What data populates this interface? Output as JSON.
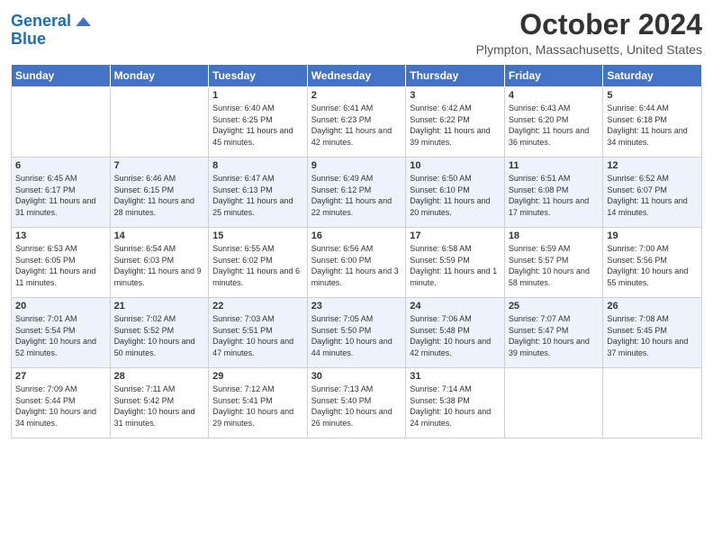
{
  "header": {
    "logo_line1": "General",
    "logo_line2": "Blue",
    "month": "October 2024",
    "location": "Plympton, Massachusetts, United States"
  },
  "days_of_week": [
    "Sunday",
    "Monday",
    "Tuesday",
    "Wednesday",
    "Thursday",
    "Friday",
    "Saturday"
  ],
  "weeks": [
    [
      {
        "day": "",
        "info": ""
      },
      {
        "day": "",
        "info": ""
      },
      {
        "day": "1",
        "info": "Sunrise: 6:40 AM\nSunset: 6:25 PM\nDaylight: 11 hours and 45 minutes."
      },
      {
        "day": "2",
        "info": "Sunrise: 6:41 AM\nSunset: 6:23 PM\nDaylight: 11 hours and 42 minutes."
      },
      {
        "day": "3",
        "info": "Sunrise: 6:42 AM\nSunset: 6:22 PM\nDaylight: 11 hours and 39 minutes."
      },
      {
        "day": "4",
        "info": "Sunrise: 6:43 AM\nSunset: 6:20 PM\nDaylight: 11 hours and 36 minutes."
      },
      {
        "day": "5",
        "info": "Sunrise: 6:44 AM\nSunset: 6:18 PM\nDaylight: 11 hours and 34 minutes."
      }
    ],
    [
      {
        "day": "6",
        "info": "Sunrise: 6:45 AM\nSunset: 6:17 PM\nDaylight: 11 hours and 31 minutes."
      },
      {
        "day": "7",
        "info": "Sunrise: 6:46 AM\nSunset: 6:15 PM\nDaylight: 11 hours and 28 minutes."
      },
      {
        "day": "8",
        "info": "Sunrise: 6:47 AM\nSunset: 6:13 PM\nDaylight: 11 hours and 25 minutes."
      },
      {
        "day": "9",
        "info": "Sunrise: 6:49 AM\nSunset: 6:12 PM\nDaylight: 11 hours and 22 minutes."
      },
      {
        "day": "10",
        "info": "Sunrise: 6:50 AM\nSunset: 6:10 PM\nDaylight: 11 hours and 20 minutes."
      },
      {
        "day": "11",
        "info": "Sunrise: 6:51 AM\nSunset: 6:08 PM\nDaylight: 11 hours and 17 minutes."
      },
      {
        "day": "12",
        "info": "Sunrise: 6:52 AM\nSunset: 6:07 PM\nDaylight: 11 hours and 14 minutes."
      }
    ],
    [
      {
        "day": "13",
        "info": "Sunrise: 6:53 AM\nSunset: 6:05 PM\nDaylight: 11 hours and 11 minutes."
      },
      {
        "day": "14",
        "info": "Sunrise: 6:54 AM\nSunset: 6:03 PM\nDaylight: 11 hours and 9 minutes."
      },
      {
        "day": "15",
        "info": "Sunrise: 6:55 AM\nSunset: 6:02 PM\nDaylight: 11 hours and 6 minutes."
      },
      {
        "day": "16",
        "info": "Sunrise: 6:56 AM\nSunset: 6:00 PM\nDaylight: 11 hours and 3 minutes."
      },
      {
        "day": "17",
        "info": "Sunrise: 6:58 AM\nSunset: 5:59 PM\nDaylight: 11 hours and 1 minute."
      },
      {
        "day": "18",
        "info": "Sunrise: 6:59 AM\nSunset: 5:57 PM\nDaylight: 10 hours and 58 minutes."
      },
      {
        "day": "19",
        "info": "Sunrise: 7:00 AM\nSunset: 5:56 PM\nDaylight: 10 hours and 55 minutes."
      }
    ],
    [
      {
        "day": "20",
        "info": "Sunrise: 7:01 AM\nSunset: 5:54 PM\nDaylight: 10 hours and 52 minutes."
      },
      {
        "day": "21",
        "info": "Sunrise: 7:02 AM\nSunset: 5:52 PM\nDaylight: 10 hours and 50 minutes."
      },
      {
        "day": "22",
        "info": "Sunrise: 7:03 AM\nSunset: 5:51 PM\nDaylight: 10 hours and 47 minutes."
      },
      {
        "day": "23",
        "info": "Sunrise: 7:05 AM\nSunset: 5:50 PM\nDaylight: 10 hours and 44 minutes."
      },
      {
        "day": "24",
        "info": "Sunrise: 7:06 AM\nSunset: 5:48 PM\nDaylight: 10 hours and 42 minutes."
      },
      {
        "day": "25",
        "info": "Sunrise: 7:07 AM\nSunset: 5:47 PM\nDaylight: 10 hours and 39 minutes."
      },
      {
        "day": "26",
        "info": "Sunrise: 7:08 AM\nSunset: 5:45 PM\nDaylight: 10 hours and 37 minutes."
      }
    ],
    [
      {
        "day": "27",
        "info": "Sunrise: 7:09 AM\nSunset: 5:44 PM\nDaylight: 10 hours and 34 minutes."
      },
      {
        "day": "28",
        "info": "Sunrise: 7:11 AM\nSunset: 5:42 PM\nDaylight: 10 hours and 31 minutes."
      },
      {
        "day": "29",
        "info": "Sunrise: 7:12 AM\nSunset: 5:41 PM\nDaylight: 10 hours and 29 minutes."
      },
      {
        "day": "30",
        "info": "Sunrise: 7:13 AM\nSunset: 5:40 PM\nDaylight: 10 hours and 26 minutes."
      },
      {
        "day": "31",
        "info": "Sunrise: 7:14 AM\nSunset: 5:38 PM\nDaylight: 10 hours and 24 minutes."
      },
      {
        "day": "",
        "info": ""
      },
      {
        "day": "",
        "info": ""
      }
    ]
  ]
}
